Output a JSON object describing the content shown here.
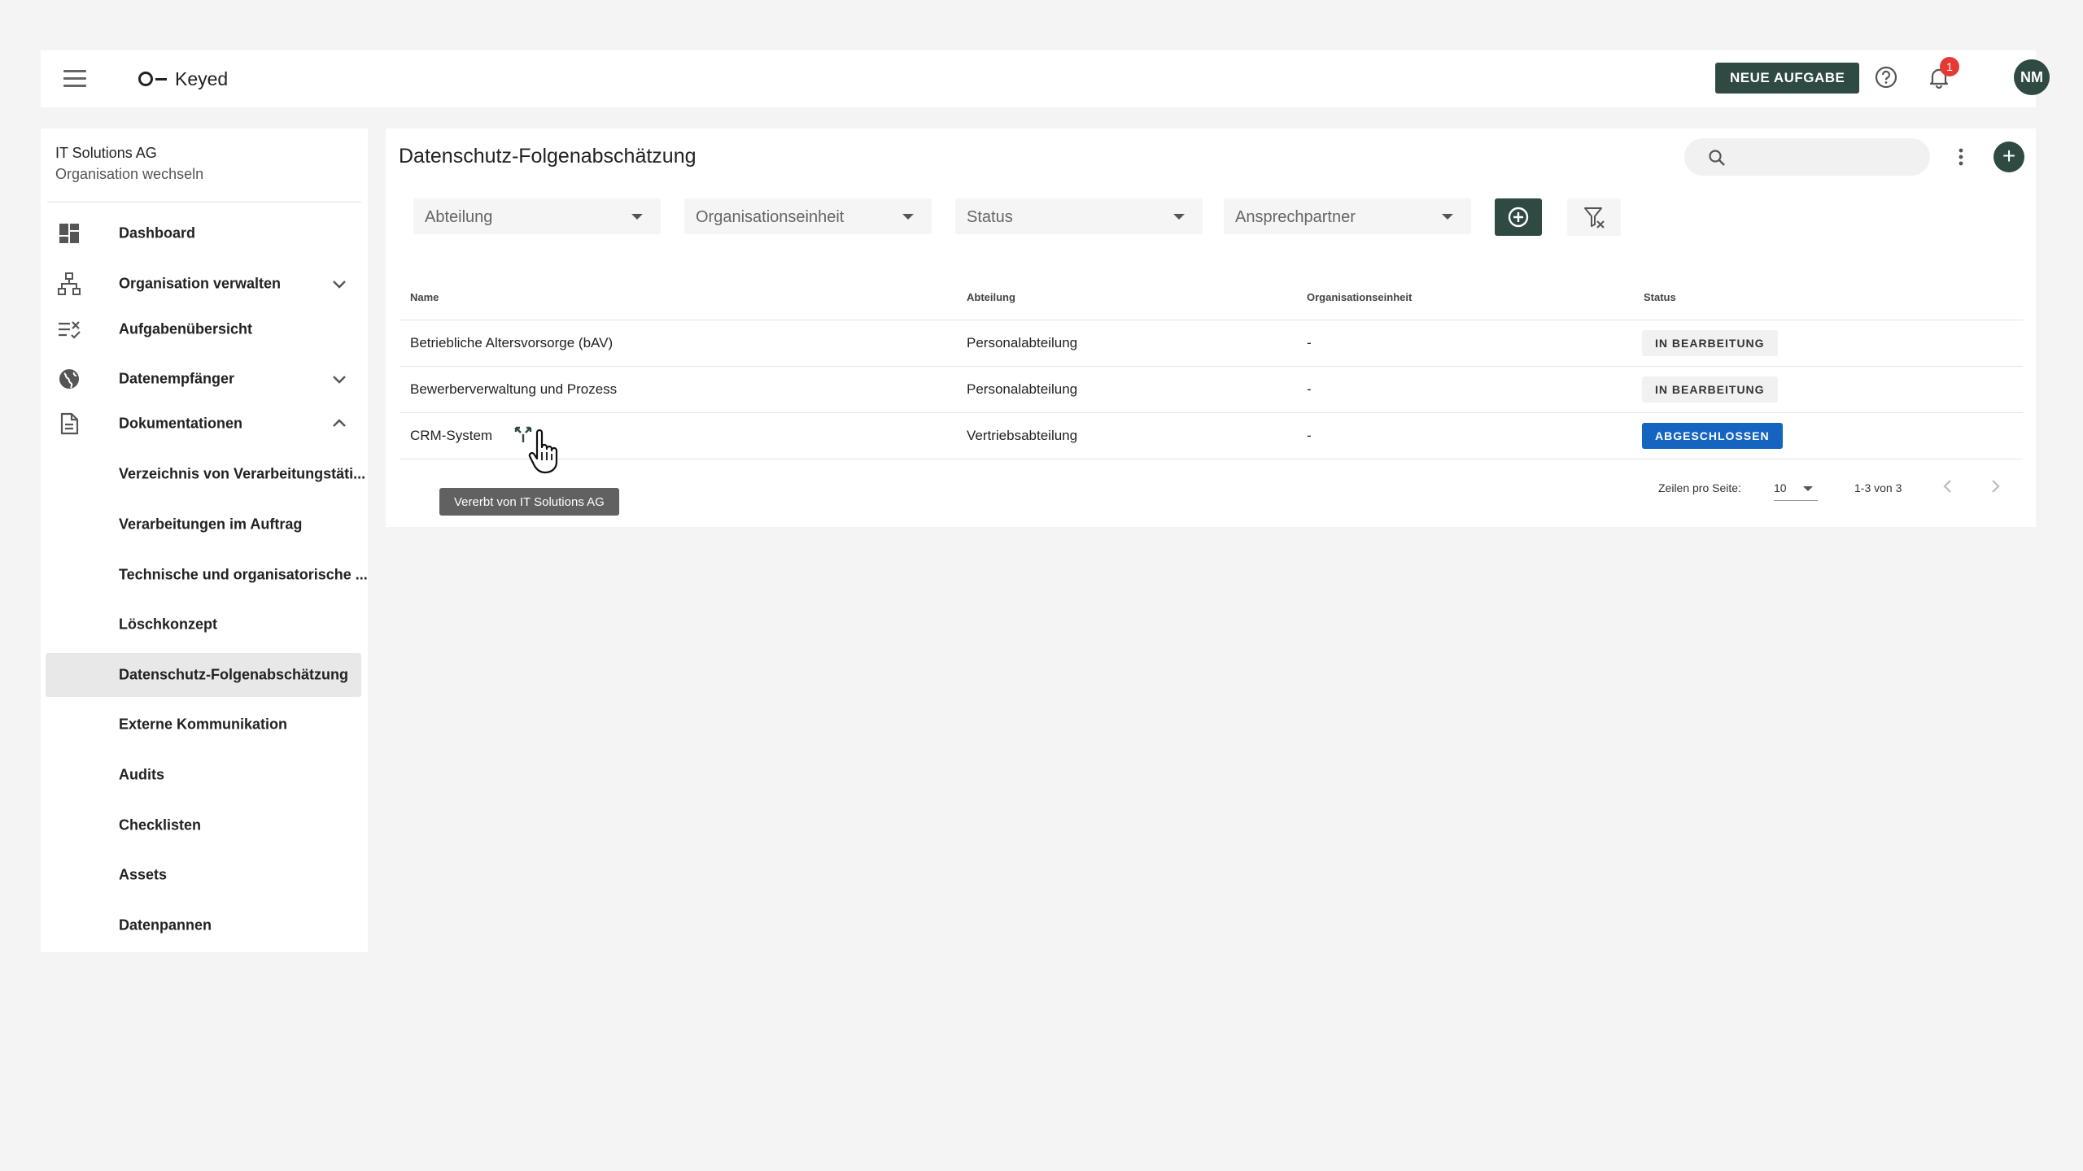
{
  "app": {
    "name": "Keyed"
  },
  "header": {
    "new_task_label": "NEUE AUFGABE",
    "notification_count": "1",
    "avatar_initials": "NM"
  },
  "sidebar": {
    "org_name": "IT Solutions AG",
    "org_switch_label": "Organisation wechseln",
    "items": [
      {
        "label": "Dashboard",
        "icon": "dashboard-icon"
      },
      {
        "label": "Organisation verwalten",
        "icon": "org-tree-icon",
        "expandable": true,
        "expanded": false
      },
      {
        "label": "Aufgabenübersicht",
        "icon": "task-list-icon"
      },
      {
        "label": "Datenempfänger",
        "icon": "globe-icon",
        "expandable": true,
        "expanded": false
      },
      {
        "label": "Dokumentationen",
        "icon": "document-icon",
        "expandable": true,
        "expanded": true
      }
    ],
    "sub_items": [
      {
        "label": "Verzeichnis von Verarbeitungstäti..."
      },
      {
        "label": "Verarbeitungen im Auftrag"
      },
      {
        "label": "Technische und organisatorische ..."
      },
      {
        "label": "Löschkonzept"
      },
      {
        "label": "Datenschutz-Folgenabschätzung",
        "active": true
      },
      {
        "label": "Externe Kommunikation"
      },
      {
        "label": "Audits"
      },
      {
        "label": "Checklisten"
      },
      {
        "label": "Assets"
      },
      {
        "label": "Datenpannen"
      }
    ]
  },
  "main": {
    "title": "Datenschutz-Folgenabschätzung",
    "search": {
      "placeholder": "",
      "value": ""
    },
    "filters": [
      {
        "label": "Abteilung"
      },
      {
        "label": "Organisationseinheit"
      },
      {
        "label": "Status"
      },
      {
        "label": "Ansprechpartner"
      }
    ],
    "table": {
      "columns": [
        "Name",
        "Abteilung",
        "Organisationseinheit",
        "Status"
      ],
      "rows": [
        {
          "name": "Betriebliche Altersvorsorge (bAV)",
          "department": "Personalabteilung",
          "unit": "-",
          "status": "IN BEARBEITUNG",
          "status_color": "#f1f1f1"
        },
        {
          "name": "Bewerberverwaltung und Prozess",
          "department": "Personalabteilung",
          "unit": "-",
          "status": "IN BEARBEITUNG",
          "status_color": "#f1f1f1"
        },
        {
          "name": "CRM-System",
          "department": "Vertriebsabteilung",
          "unit": "-",
          "status": "ABGESCHLOSSEN",
          "status_color": "#1565c0"
        }
      ]
    },
    "tooltip": "Vererbt von IT Solutions AG",
    "pagination": {
      "rows_per_page_label": "Zeilen pro Seite:",
      "rows_per_page": "10",
      "range": "1-3 von 3"
    }
  },
  "colors": {
    "primary": "#2f4a43",
    "status_done": "#1565c0",
    "badge": "#e53935"
  }
}
